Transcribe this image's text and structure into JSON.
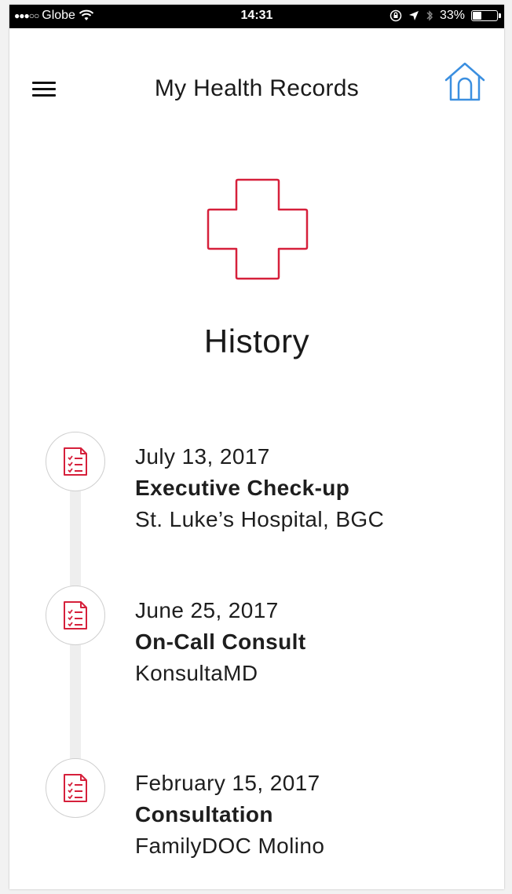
{
  "status_bar": {
    "carrier": "Globe",
    "time": "14:31",
    "battery_percent": "33%",
    "battery_level": 0.33
  },
  "header": {
    "title": "My Health Records",
    "menu_icon": "hamburger-menu-icon",
    "home_icon": "home-icon"
  },
  "main": {
    "hero_icon": "medical-cross-icon",
    "section_title": "History"
  },
  "history": [
    {
      "date": "July 13, 2017",
      "type": "Executive Check-up",
      "place": "St. Luke’s Hospital, BGC"
    },
    {
      "date": "June 25, 2017",
      "type": "On-Call Consult",
      "place": "KonsultaMD"
    },
    {
      "date": "February 15, 2017",
      "type": "Consultation",
      "place": "FamilyDOC Molino"
    }
  ],
  "colors": {
    "accent_red": "#d6203b",
    "home_blue": "#3b8fe0",
    "text": "#1a1a1a",
    "timeline_line": "#eeeeee"
  }
}
